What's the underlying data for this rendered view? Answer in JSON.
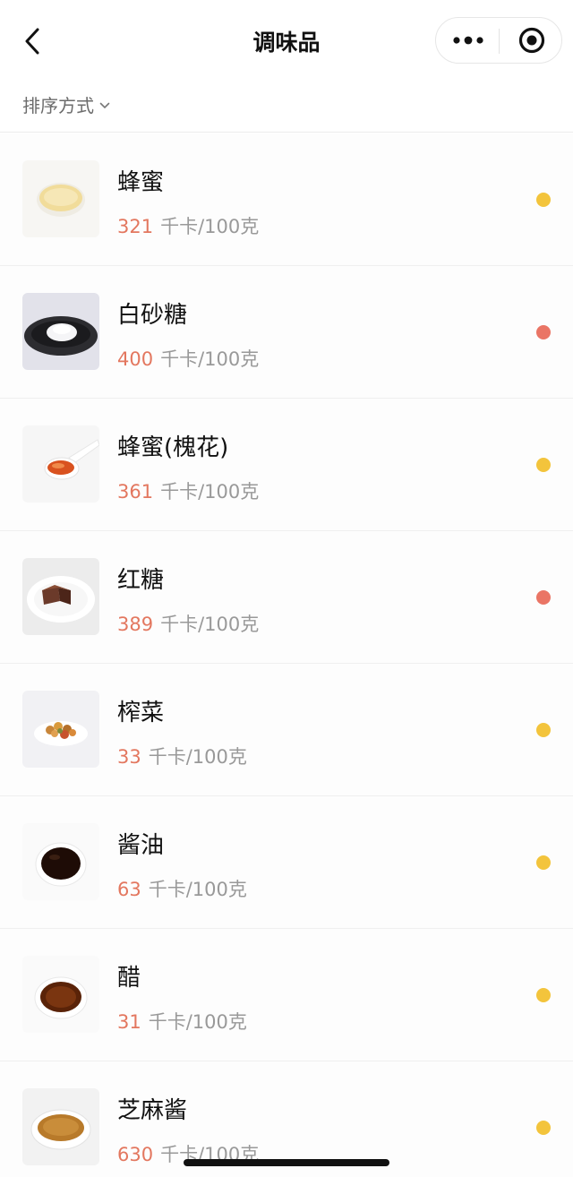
{
  "nav": {
    "title": "调味品",
    "back_icon": "chevron-left-icon",
    "more_icon": "more-dots-icon",
    "close_icon": "target-circle-icon"
  },
  "sort": {
    "label": "排序方式",
    "icon": "chevron-down-icon"
  },
  "items": [
    {
      "name": "蜂蜜",
      "calories": "321",
      "unit": "千卡/100克",
      "dot_color": "#f3c43c",
      "image": "honey-bowl"
    },
    {
      "name": "白砂糖",
      "calories": "400",
      "unit": "千卡/100克",
      "dot_color": "#ea7565",
      "image": "sugar-plate"
    },
    {
      "name": "蜂蜜(槐花)",
      "calories": "361",
      "unit": "千卡/100克",
      "dot_color": "#f3c43c",
      "image": "honey-spoon"
    },
    {
      "name": "红糖",
      "calories": "389",
      "unit": "千卡/100克",
      "dot_color": "#ea7565",
      "image": "brown-sugar-plate"
    },
    {
      "name": "榨菜",
      "calories": "33",
      "unit": "千卡/100克",
      "dot_color": "#f3c43c",
      "image": "pickle-plate"
    },
    {
      "name": "酱油",
      "calories": "63",
      "unit": "千卡/100克",
      "dot_color": "#f3c43c",
      "image": "soy-sauce-bowl"
    },
    {
      "name": "醋",
      "calories": "31",
      "unit": "千卡/100克",
      "dot_color": "#f3c43c",
      "image": "vinegar-bowl"
    },
    {
      "name": "芝麻酱",
      "calories": "630",
      "unit": "千卡/100克",
      "dot_color": "#f3c43c",
      "image": "sesame-paste-bowl"
    }
  ]
}
